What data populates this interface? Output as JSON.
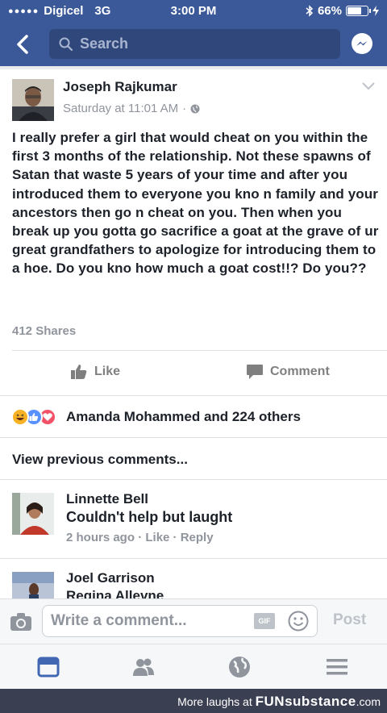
{
  "status_bar": {
    "carrier": "Digicel",
    "network": "3G",
    "time": "3:00 PM",
    "battery": "66%",
    "battery_level": 0.66
  },
  "nav": {
    "search_placeholder": "Search",
    "accent": "#3b5998"
  },
  "post": {
    "author": "Joseph Rajkumar",
    "timestamp": "Saturday at 11:01 AM",
    "separator": "·",
    "text": "I really prefer a girl that would cheat on you within the first 3 months of the relationship. Not these spawns of Satan that waste 5 years of your time and after you introduced them to everyone you kno n family and your ancestors then go n cheat on you. Then when you break up you gotta go sacrifice a goat at the grave of ur great grandfathers to apologize for introducing them to a hoe. Do you kno how much a goat cost!!? Do you??",
    "shares": "412 Shares",
    "like_label": "Like",
    "comment_label": "Comment"
  },
  "reactions": {
    "summary": "Amanda Mohammed and 224 others",
    "icons": [
      "haha-icon",
      "like-icon",
      "love-icon"
    ]
  },
  "view_previous": "View previous comments...",
  "comments": [
    {
      "name": "Linnette Bell",
      "text": "Couldn't help but laught",
      "time": "2 hours ago",
      "like": "Like",
      "reply": "Reply",
      "sep": "·"
    },
    {
      "name": "Joel Garrison",
      "text": "Regina Allevne"
    }
  ],
  "composer": {
    "placeholder": "Write a comment...",
    "gif_label": "GIF",
    "post_label": "Post"
  },
  "tabs": [
    "news-feed-icon",
    "friends-icon",
    "globe-icon",
    "menu-icon"
  ],
  "watermark": {
    "prefix": "More laughs at",
    "brand": "FUNsubstance",
    "suffix": ".com"
  }
}
